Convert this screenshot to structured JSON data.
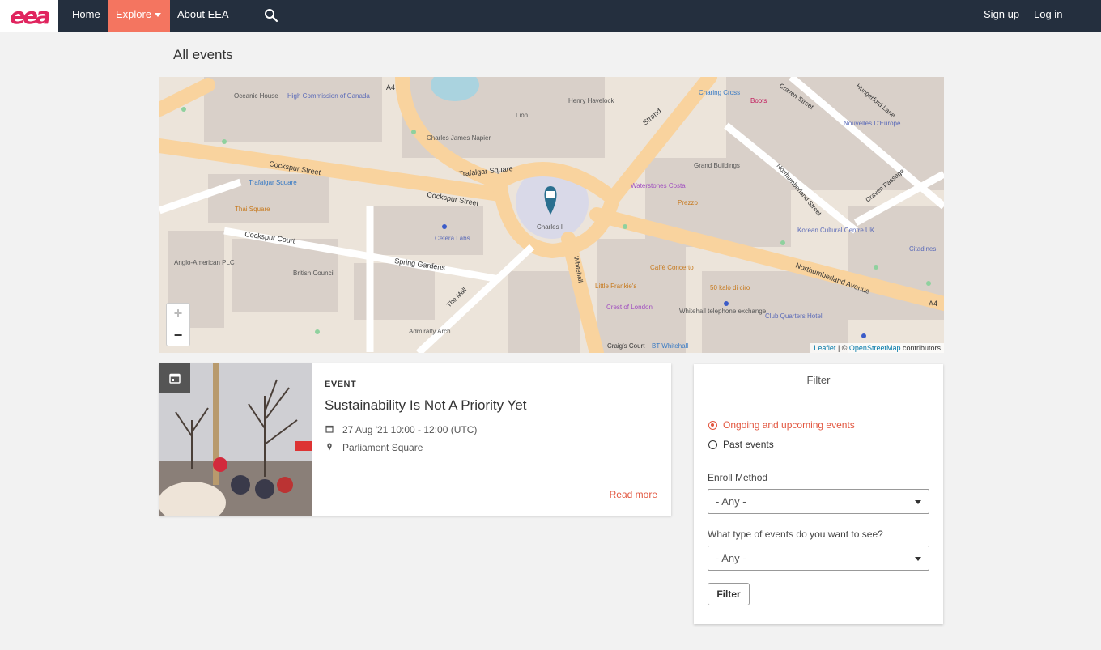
{
  "nav": {
    "logo_text": "eea",
    "home": "Home",
    "explore": "Explore",
    "about": "About EEA",
    "signup": "Sign up",
    "login": "Log in",
    "accent_color": "#f47560",
    "bar_color": "#242f3e"
  },
  "page": {
    "title": "All events"
  },
  "map": {
    "zoom_in": "+",
    "zoom_out": "−",
    "attribution_leaflet": "Leaflet",
    "attribution_sep": " | © ",
    "attribution_osm": "OpenStreetMap",
    "attribution_tail": " contributors",
    "labels": {
      "cockspur_street": "Cockspur Street",
      "cockspur_street2": "Cockspur Street",
      "trafalgar_square": "Trafalgar Square",
      "strand": "Strand",
      "northumberland_avenue": "Northumberland Avenue",
      "northumberland_street": "Northumberland Street",
      "whitehall": "Whitehall",
      "the_mall": "The Mall",
      "spring_gardens": "Spring Gardens",
      "cockspur_court": "Cockspur Court",
      "craigs_court": "Craig's Court",
      "oceanic_house": "Oceanic House",
      "high_commission": "High Commission of Canada",
      "charles_james_napier": "Charles James Napier",
      "henry_havelock": "Henry Havelock",
      "lion": "Lion",
      "british_council": "British Council",
      "anglo_american": "Anglo-American PLC",
      "admiralty_arch": "Admiralty Arch",
      "grand_buildings": "Grand Buildings",
      "waterstones": "Waterstones Costa",
      "prezzo": "Prezzo",
      "charing_cross": "Charing Cross",
      "boots": "Boots",
      "craven_street": "Craven Street",
      "hungerford_lane": "Hungerford Lane",
      "nouvelles": "Nouvelles D'Europe",
      "craven_passage": "Craven Passage",
      "korean_centre": "Korean Cultural Centre UK",
      "citadines": "Citadines",
      "club_quarters": "Club Quarters Hotel",
      "whitehall_exchange": "Whitehall telephone exchange",
      "caffe_concerto": "Caffè Concerto",
      "little_frankies": "Little Frankie's",
      "crest_of_london": "Crest of London",
      "fifty_kalo": "50 kalò di ciro",
      "thai_square": "Thai Square",
      "trafalgar_square_small": "Trafalgar Square",
      "cetera_labs": "Cetera Labs",
      "charles_statue": "Charles I",
      "a4": "A4",
      "a4_right": "A4",
      "bt_whitehall": "BT Whitehall"
    }
  },
  "event": {
    "type": "EVENT",
    "title": "Sustainability Is Not A Priority Yet",
    "date": "27 Aug '21 10:00 - 12:00 (UTC)",
    "location": "Parliament Square",
    "read_more": "Read more"
  },
  "filter": {
    "title": "Filter",
    "option_upcoming": "Ongoing and upcoming events",
    "option_past": "Past events",
    "enroll_label": "Enroll Method",
    "enroll_value": "- Any -",
    "type_label": "What type of events do you want to see?",
    "type_value": "- Any -",
    "button": "Filter",
    "accent_color": "#e2563f"
  }
}
